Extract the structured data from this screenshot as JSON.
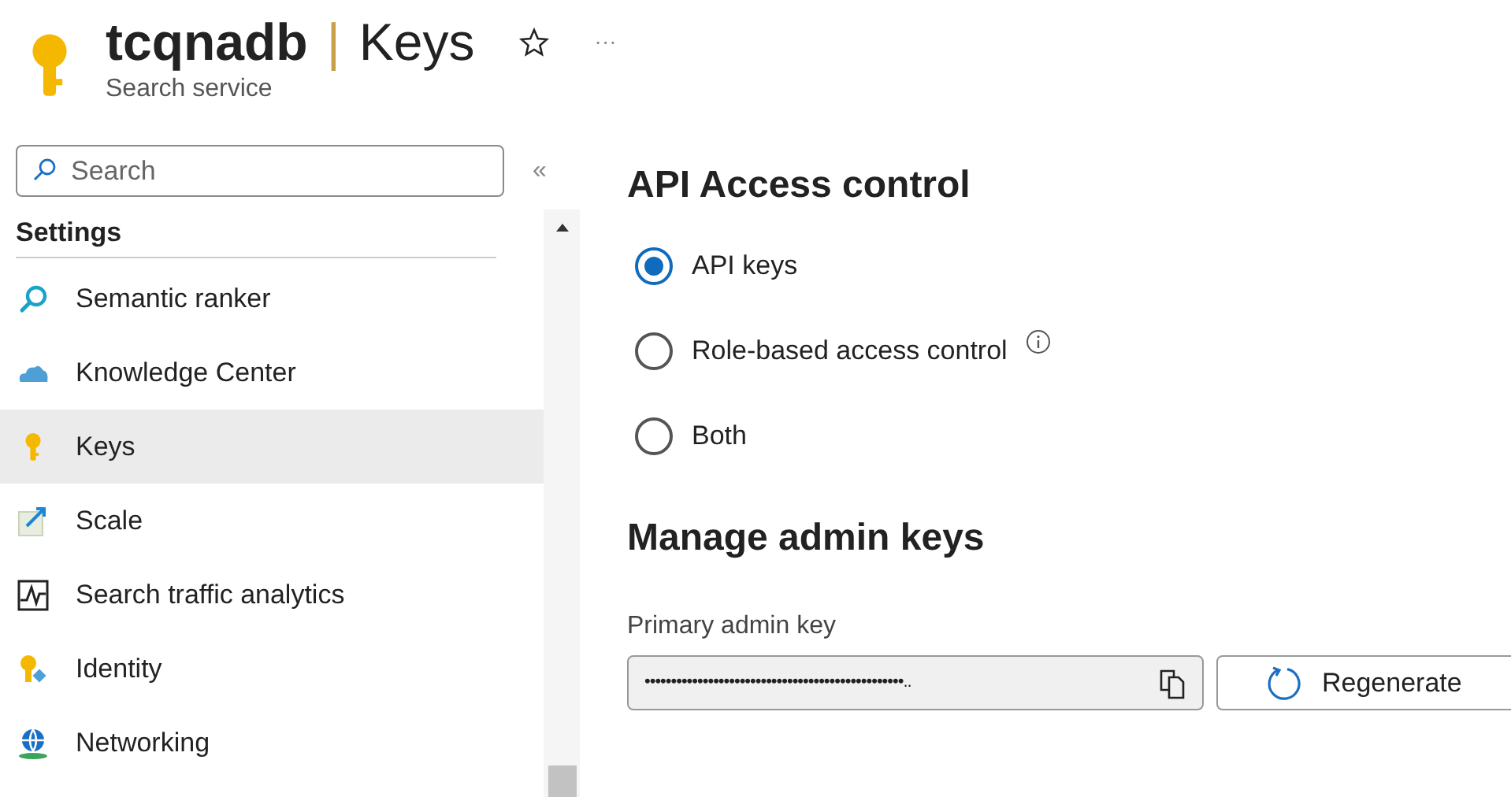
{
  "header": {
    "resource": "tcqnadb",
    "separator": "|",
    "page": "Keys",
    "subtitle": "Search service",
    "favorite": false,
    "more": "···"
  },
  "sidebar": {
    "search": {
      "placeholder": "Search"
    },
    "collapse": "«",
    "section": "Settings",
    "items": [
      {
        "label": "Semantic ranker",
        "selected": false
      },
      {
        "label": "Knowledge Center",
        "selected": false
      },
      {
        "label": "Keys",
        "selected": true
      },
      {
        "label": "Scale",
        "selected": false
      },
      {
        "label": "Search traffic analytics",
        "selected": false
      },
      {
        "label": "Identity",
        "selected": false
      },
      {
        "label": "Networking",
        "selected": false
      }
    ]
  },
  "api_access": {
    "title": "API Access control",
    "options": [
      {
        "label": "API keys",
        "selected": true,
        "info": false
      },
      {
        "label": "Role-based access control",
        "selected": false,
        "info": true
      },
      {
        "label": "Both",
        "selected": false,
        "info": false
      }
    ]
  },
  "admin_keys": {
    "title": "Manage admin keys",
    "primary_label": "Primary admin key",
    "primary_value": "•••••••••••••••••••••••••••••••••••••••••••••••••..",
    "regenerate": "Regenerate"
  }
}
